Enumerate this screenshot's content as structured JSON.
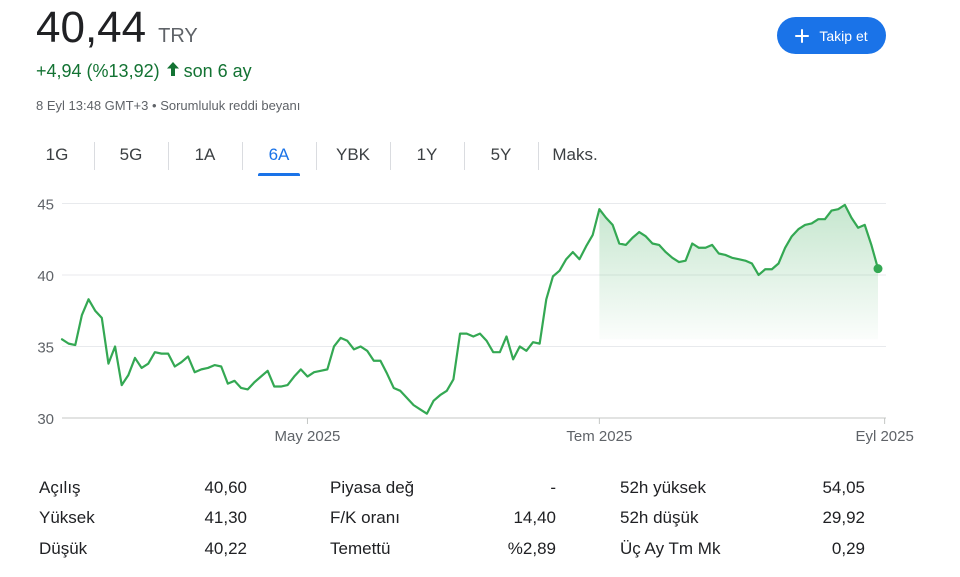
{
  "quote": {
    "price": "40,44",
    "currency": "TRY",
    "change": "+4,94 (%13,92)",
    "change_period": "son 6 ay",
    "timestamp": "8 Eyl 13:48 GMT+3",
    "separator": "•",
    "disclaimer": "Sorumluluk reddi beyanı"
  },
  "follow_button": {
    "label": "Takip et"
  },
  "range_tabs": [
    {
      "label": "1G",
      "active": false
    },
    {
      "label": "5G",
      "active": false
    },
    {
      "label": "1A",
      "active": false
    },
    {
      "label": "6A",
      "active": true
    },
    {
      "label": "YBK",
      "active": false
    },
    {
      "label": "1Y",
      "active": false
    },
    {
      "label": "5Y",
      "active": false
    },
    {
      "label": "Maks.",
      "active": false
    }
  ],
  "colors": {
    "line": "#34a853",
    "positive_text": "#137333",
    "accent": "#1a73e8",
    "grid": "#e8eaed",
    "axis_text": "#5f6368"
  },
  "chart_data": {
    "type": "area",
    "ylim": [
      30,
      45.8
    ],
    "yticks": [
      30,
      35,
      40,
      45
    ],
    "ytick_labels": [
      "30",
      "35",
      "40",
      "45"
    ],
    "x_ticks": [
      {
        "index": 37,
        "label": "May 2025"
      },
      {
        "index": 81,
        "label": "Tem 2025"
      },
      {
        "index": 124,
        "label": "Eyl 2025"
      }
    ],
    "fill_from_index": 81,
    "grid": true,
    "previous_close": 35.5,
    "values": [
      35.5,
      35.2,
      35.1,
      37.2,
      38.3,
      37.5,
      37.0,
      33.8,
      35.0,
      32.3,
      33.0,
      34.2,
      33.5,
      33.8,
      34.6,
      34.5,
      34.5,
      33.6,
      33.9,
      34.3,
      33.2,
      33.4,
      33.5,
      33.7,
      33.6,
      32.4,
      32.6,
      32.1,
      32.0,
      32.5,
      32.9,
      33.3,
      32.2,
      32.2,
      32.3,
      32.9,
      33.4,
      32.9,
      33.2,
      33.3,
      33.4,
      35.0,
      35.6,
      35.4,
      34.8,
      35.0,
      34.7,
      34.0,
      34.0,
      33.1,
      32.1,
      31.9,
      31.4,
      30.9,
      30.6,
      30.3,
      31.2,
      31.6,
      31.9,
      32.7,
      35.9,
      35.9,
      35.7,
      35.9,
      35.4,
      34.6,
      34.6,
      35.7,
      34.1,
      35.0,
      34.7,
      35.3,
      35.2,
      38.3,
      39.9,
      40.3,
      41.1,
      41.6,
      41.1,
      42.0,
      42.8,
      44.6,
      44.0,
      43.5,
      42.2,
      42.1,
      42.6,
      43.0,
      42.7,
      42.2,
      42.1,
      41.6,
      41.2,
      40.9,
      41.0,
      42.2,
      41.9,
      41.9,
      42.1,
      41.5,
      41.4,
      41.2,
      41.1,
      41.0,
      40.8,
      40.0,
      40.4,
      40.4,
      40.8,
      41.9,
      42.7,
      43.2,
      43.5,
      43.6,
      43.9,
      43.9,
      44.5,
      44.6,
      44.9,
      44.0,
      43.3,
      43.5,
      42.1,
      40.44
    ]
  },
  "stats": {
    "col1": [
      {
        "label": "Açılış",
        "value": "40,60"
      },
      {
        "label": "Yüksek",
        "value": "41,30"
      },
      {
        "label": "Düşük",
        "value": "40,22"
      }
    ],
    "col2": [
      {
        "label": "Piyasa değ",
        "value": "-"
      },
      {
        "label": "F/K oranı",
        "value": "14,40"
      },
      {
        "label": "Temettü",
        "value": "%2,89"
      }
    ],
    "col3": [
      {
        "label": "52h yüksek",
        "value": "54,05"
      },
      {
        "label": "52h düşük",
        "value": "29,92"
      },
      {
        "label": "Üç Ay Tm Mk",
        "value": "0,29"
      }
    ]
  }
}
